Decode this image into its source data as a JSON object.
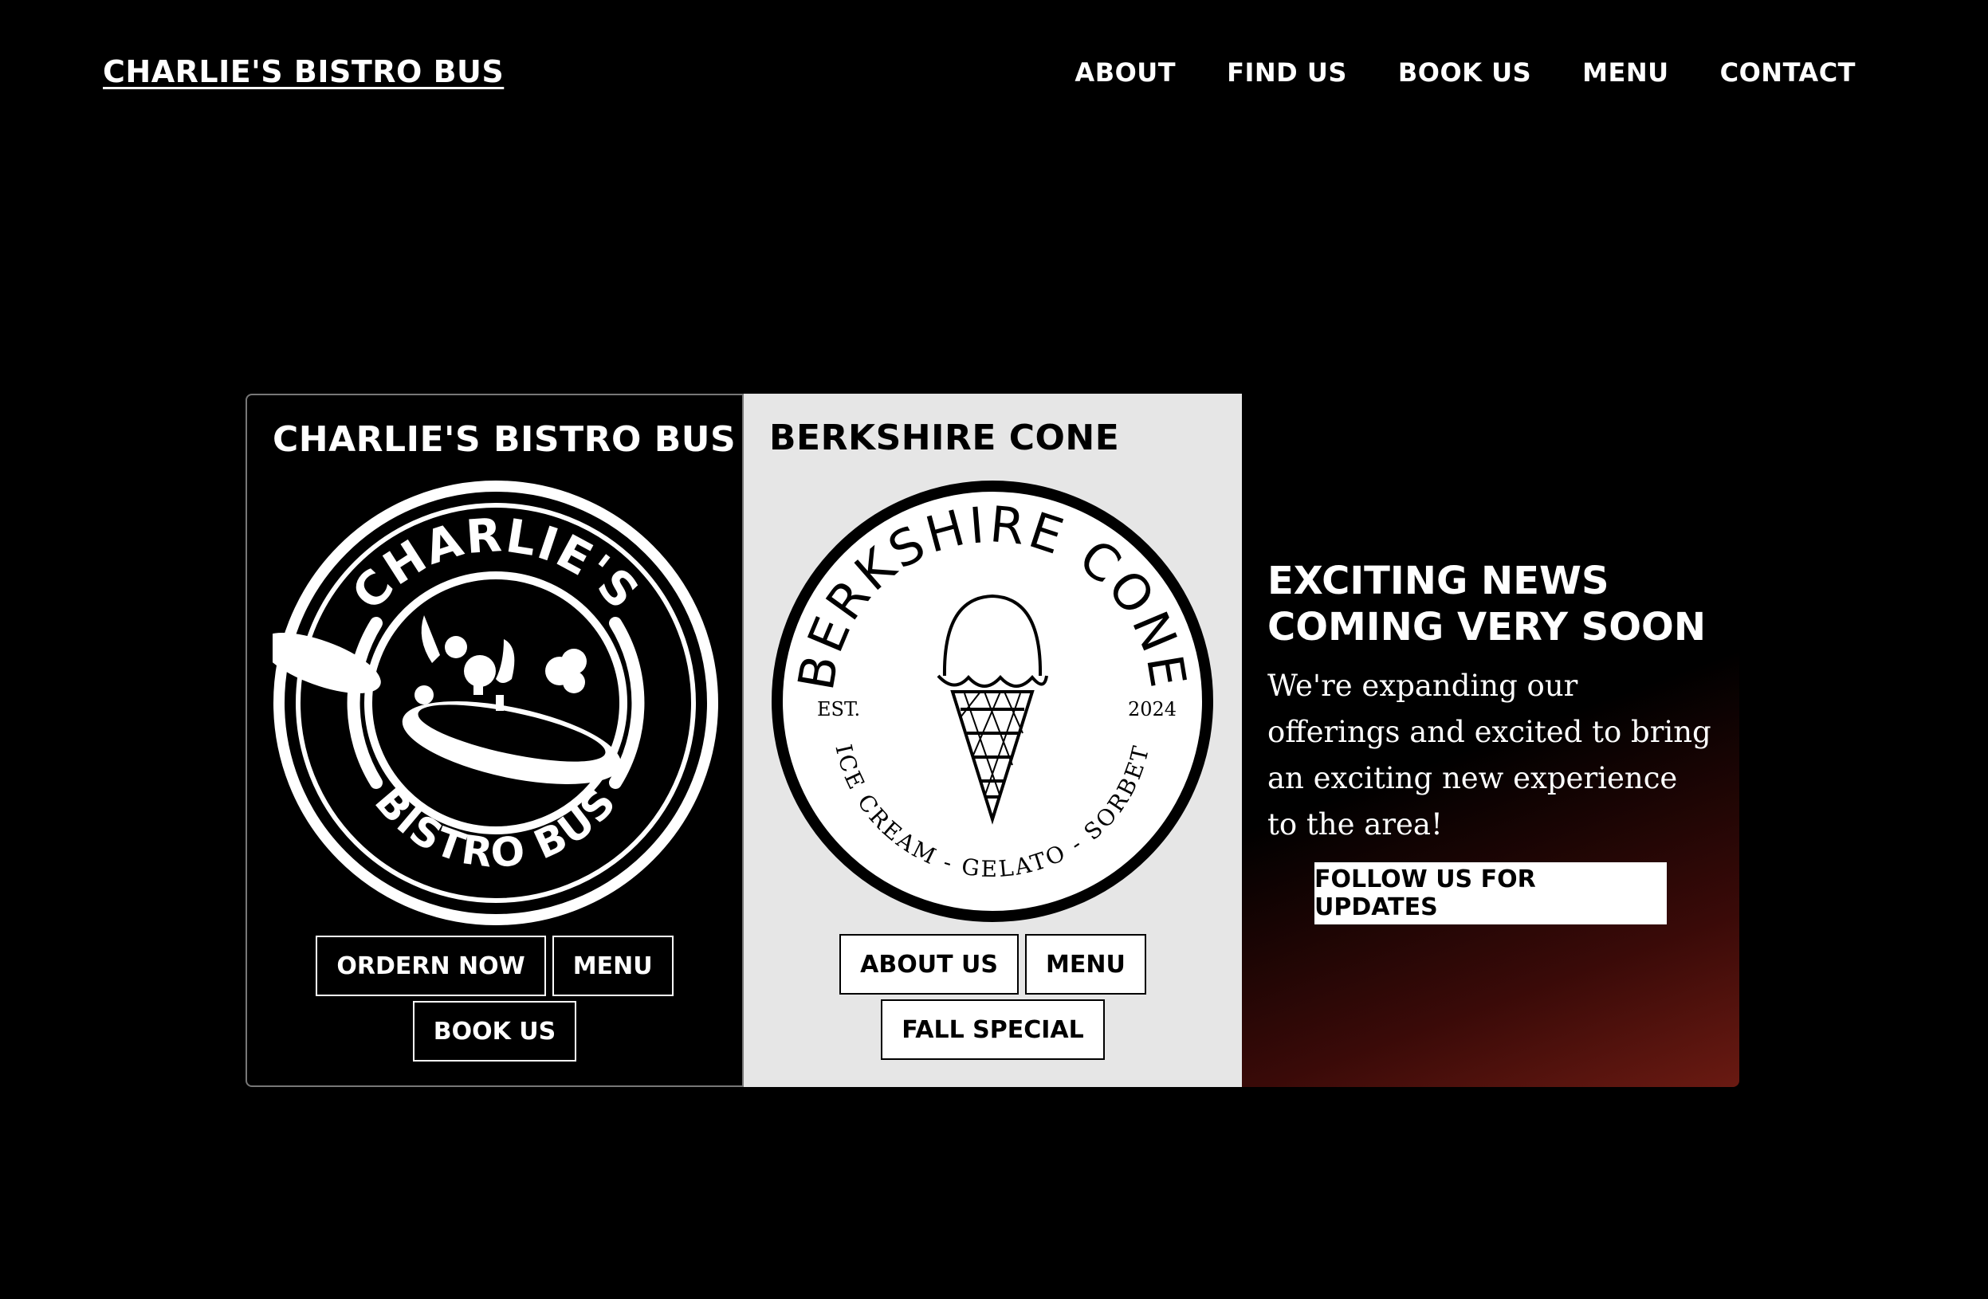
{
  "header": {
    "brand": "CHARLIE'S BISTRO BUS",
    "nav": [
      "ABOUT",
      "FIND US",
      "BOOK US",
      "MENU",
      "CONTACT"
    ]
  },
  "cards": {
    "bistro": {
      "title": "CHARLIE'S BISTRO BUS",
      "logo_top_text": "CHARLIE'S",
      "logo_bottom_text": "BISTRO BUS",
      "buttons": [
        "ORDERN NOW",
        "MENU",
        "BOOK US"
      ]
    },
    "cone": {
      "title": "BERKSHIRE CONE",
      "logo_top_text": "BERKSHIRE CONE",
      "logo_est": "EST.",
      "logo_year": "2024",
      "logo_bottom_text": "ICE CREAM - GELATO - SORBET",
      "buttons": [
        "ABOUT US",
        "MENU",
        "FALL SPECIAL"
      ]
    },
    "news": {
      "heading_line1": "EXCITING NEWS",
      "heading_line2": "COMING VERY SOON",
      "body": "We're expanding our offerings and excited to bring an exciting new experience to the area!",
      "button": "FOLLOW US FOR UPDATES"
    }
  },
  "colors": {
    "background": "#000000",
    "cone_card_bg": "#e6e6e6",
    "news_gradient_accent": "#6a1a12"
  },
  "icons": [
    "charlies-bistro-bus-logo",
    "berkshire-cone-logo",
    "pan-icon",
    "ice-cream-cone-icon"
  ]
}
